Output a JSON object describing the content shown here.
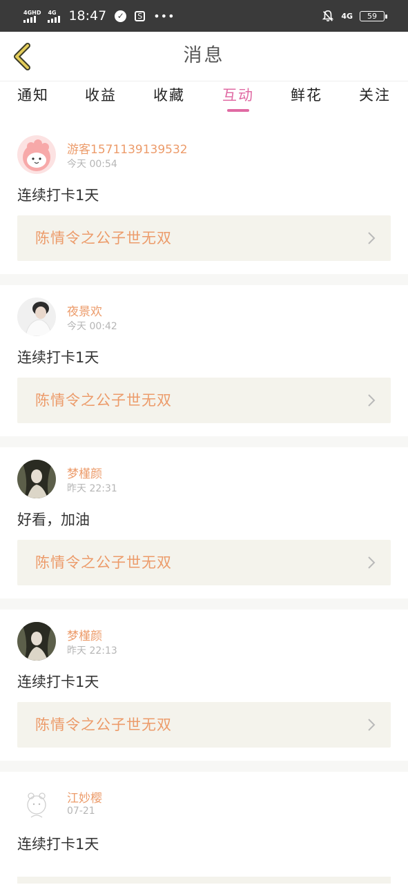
{
  "status_bar": {
    "sig1_label": "4GHD",
    "sig2_label": "4G",
    "time": "18:47",
    "right_net": "4G",
    "battery": "59"
  },
  "header": {
    "title": "消息"
  },
  "tabs": [
    {
      "label": "通知",
      "active": false
    },
    {
      "label": "收益",
      "active": false
    },
    {
      "label": "收藏",
      "active": false
    },
    {
      "label": "互动",
      "active": true
    },
    {
      "label": "鲜花",
      "active": false
    },
    {
      "label": "关注",
      "active": false
    }
  ],
  "messages": [
    {
      "user": "游客1571139139532",
      "time": "今天 00:54",
      "text": "连续打卡1天",
      "book": "陈情令之公子世无双"
    },
    {
      "user": "夜景欢",
      "time": "今天 00:42",
      "text": "连续打卡1天",
      "book": "陈情令之公子世无双"
    },
    {
      "user": "梦槿颜",
      "time": "昨天 22:31",
      "text": "好看，加油",
      "book": "陈情令之公子世无双"
    },
    {
      "user": "梦槿颜",
      "time": "昨天 22:13",
      "text": "连续打卡1天",
      "book": "陈情令之公子世无双"
    },
    {
      "user": "江妙樱",
      "time": "07-21",
      "text": "连续打卡1天",
      "book": ""
    }
  ],
  "colors": {
    "accent": "#e06aa3",
    "username": "#ec9b6a",
    "book_title": "#ec9b6a",
    "back_arrow": "#e4cd5a"
  }
}
